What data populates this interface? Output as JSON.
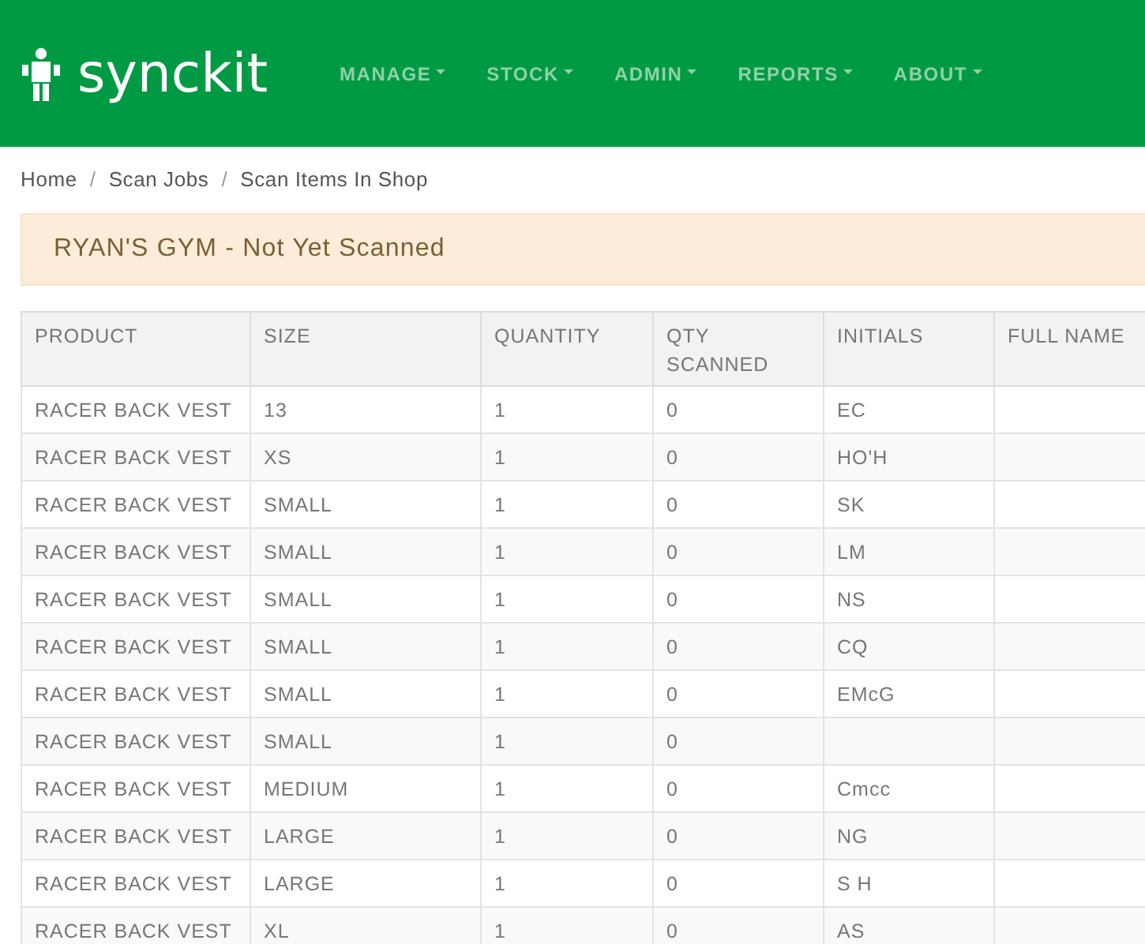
{
  "header": {
    "logo": "synckit",
    "nav": [
      {
        "label": "MANAGE"
      },
      {
        "label": "STOCK"
      },
      {
        "label": "ADMIN"
      },
      {
        "label": "REPORTS"
      },
      {
        "label": "ABOUT"
      }
    ]
  },
  "breadcrumb": {
    "separator": "/",
    "items": [
      "Home",
      "Scan Jobs",
      "Scan Items In Shop"
    ]
  },
  "alert": "RYAN'S GYM - Not Yet Scanned",
  "table": {
    "columns": [
      "PRODUCT",
      "SIZE",
      "QUANTITY",
      "QTY SCANNED",
      "INITIALS",
      "FULL NAME"
    ],
    "rows": [
      [
        "RACER BACK VEST",
        "13",
        "1",
        "0",
        "EC"
      ],
      [
        "RACER BACK VEST",
        "XS",
        "1",
        "0",
        "HO'H"
      ],
      [
        "RACER BACK VEST",
        "SMALL",
        "1",
        "0",
        "SK"
      ],
      [
        "RACER BACK VEST",
        "SMALL",
        "1",
        "0",
        "LM"
      ],
      [
        "RACER BACK VEST",
        "SMALL",
        "1",
        "0",
        "NS"
      ],
      [
        "RACER BACK VEST",
        "SMALL",
        "1",
        "0",
        "CQ"
      ],
      [
        "RACER BACK VEST",
        "SMALL",
        "1",
        "0",
        "EMcG"
      ],
      [
        "RACER BACK VEST",
        "SMALL",
        "1",
        "0"
      ],
      [
        "RACER BACK VEST",
        "MEDIUM",
        "1",
        "0",
        "Cmcc"
      ],
      [
        "RACER BACK VEST",
        "LARGE",
        "1",
        "0",
        "NG"
      ],
      [
        "RACER BACK VEST",
        "LARGE",
        "1",
        "0",
        "S H"
      ],
      [
        "RACER BACK VEST",
        "XL",
        "1",
        "0",
        "AS"
      ]
    ]
  }
}
